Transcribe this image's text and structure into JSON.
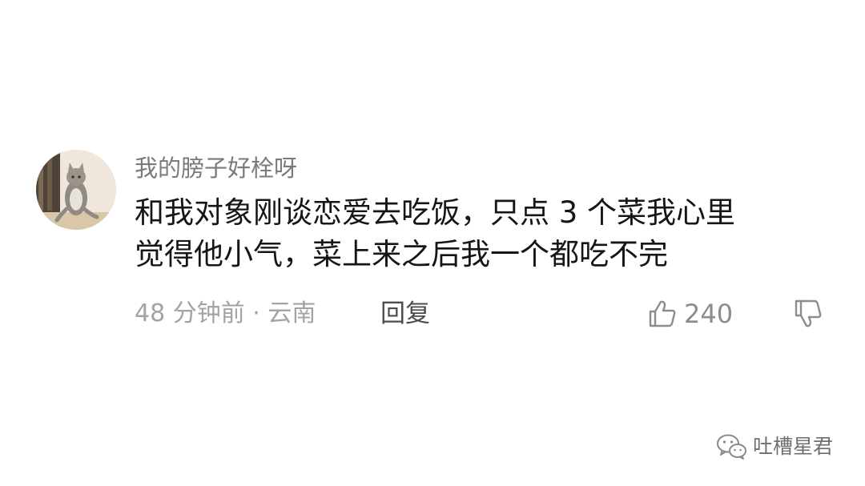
{
  "comment": {
    "username": "我的膀子好栓呀",
    "lines": [
      "和我对象刚谈恋爱去吃饭，只点 3 个菜我心里",
      "觉得他小气，菜上来之后我一个都吃不完"
    ],
    "time": "48 分钟前 · 云南",
    "reply_label": "回复",
    "likes": "240",
    "avatar_icon": "cat-photo-avatar",
    "like_icon": "thumbs-up-icon",
    "dislike_icon": "thumbs-down-icon"
  },
  "watermark": {
    "text": "吐槽星君",
    "icon": "wechat-icon"
  }
}
